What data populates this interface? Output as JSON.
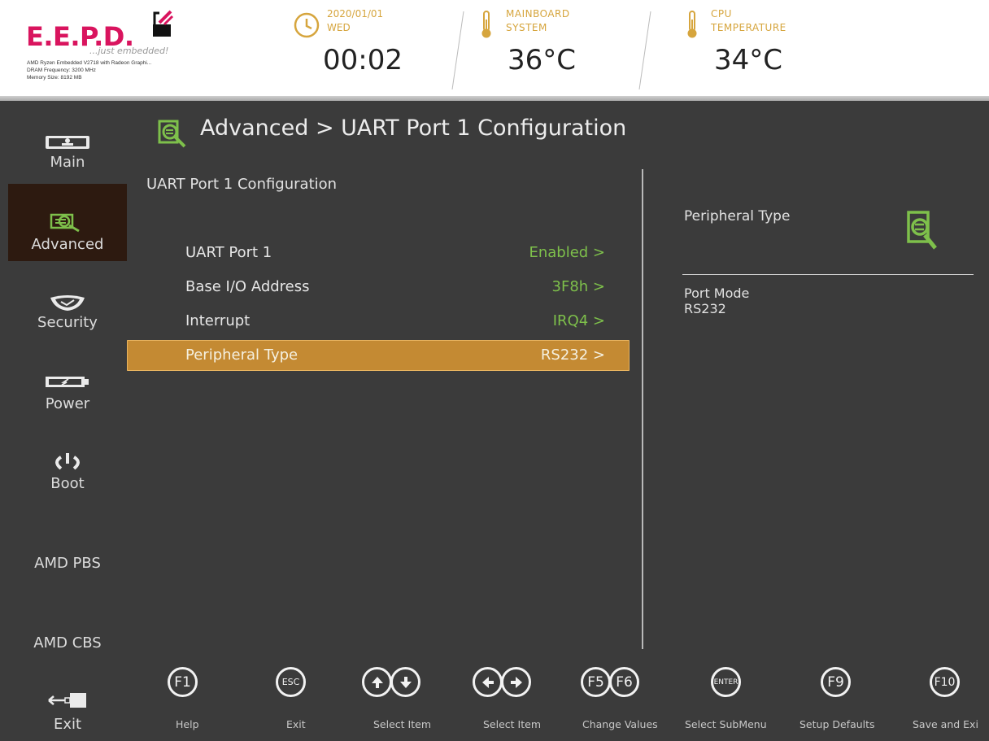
{
  "header": {
    "logo": "E.E.P.D.",
    "tagline": "...just embedded!",
    "sysinfo": [
      "AMD Ryzen Embedded V2718 with Radeon Graphi...",
      "DRAM Frequency: 3200 MHz",
      "Memory Size: 8192 MB"
    ],
    "date": "2020/01/01",
    "weekday": "WED",
    "time": "00:02",
    "mainboard_label_1": "MAINBOARD",
    "mainboard_label_2": "SYSTEM",
    "mainboard_temp": "36°C",
    "cpu_label_1": "CPU",
    "cpu_label_2": "TEMPERATURE",
    "cpu_temp": "34°C",
    "accent_color": "#d6a53d",
    "brand_color": "#d9145e"
  },
  "sidebar": {
    "items": [
      {
        "label": "Main",
        "icon": "monitor-icon"
      },
      {
        "label": "Advanced",
        "icon": "advanced-icon",
        "active": true
      },
      {
        "label": "Security",
        "icon": "shield-icon"
      },
      {
        "label": "Power",
        "icon": "battery-icon"
      },
      {
        "label": "Boot",
        "icon": "power-icon"
      },
      {
        "label": "AMD PBS"
      },
      {
        "label": "AMD CBS"
      },
      {
        "label": "Exit",
        "icon": "exit-icon"
      }
    ]
  },
  "main": {
    "breadcrumb": "Advanced > UART Port 1 Configuration",
    "section_title": "UART Port 1 Configuration",
    "rows": [
      {
        "name": "UART Port 1",
        "value": "Enabled >"
      },
      {
        "name": "Base I/O Address",
        "value": "3F8h >"
      },
      {
        "name": "Interrupt",
        "value": "IRQ4 >"
      },
      {
        "name": "Peripheral Type",
        "value": "RS232 >",
        "selected": true
      }
    ],
    "value_color": "#7ec04b",
    "selected_color": "#c48a33"
  },
  "help": {
    "title": "Peripheral Type",
    "line1": "Port Mode",
    "line2": "RS232"
  },
  "footer": {
    "keys": [
      {
        "keys": [
          "F1"
        ],
        "label": "Help"
      },
      {
        "keys": [
          "ESC"
        ],
        "label": "Exit"
      },
      {
        "keys": [
          "up-arrow",
          "down-arrow"
        ],
        "label": "Select Item"
      },
      {
        "keys": [
          "left-arrow",
          "right-arrow"
        ],
        "label": "Select Item"
      },
      {
        "keys": [
          "F5",
          "F6"
        ],
        "label": "Change Values"
      },
      {
        "keys": [
          "ENTER"
        ],
        "label": "Select SubMenu"
      },
      {
        "keys": [
          "F9"
        ],
        "label": "Setup Defaults"
      },
      {
        "keys": [
          "F10"
        ],
        "label": "Save and Exi"
      }
    ]
  }
}
